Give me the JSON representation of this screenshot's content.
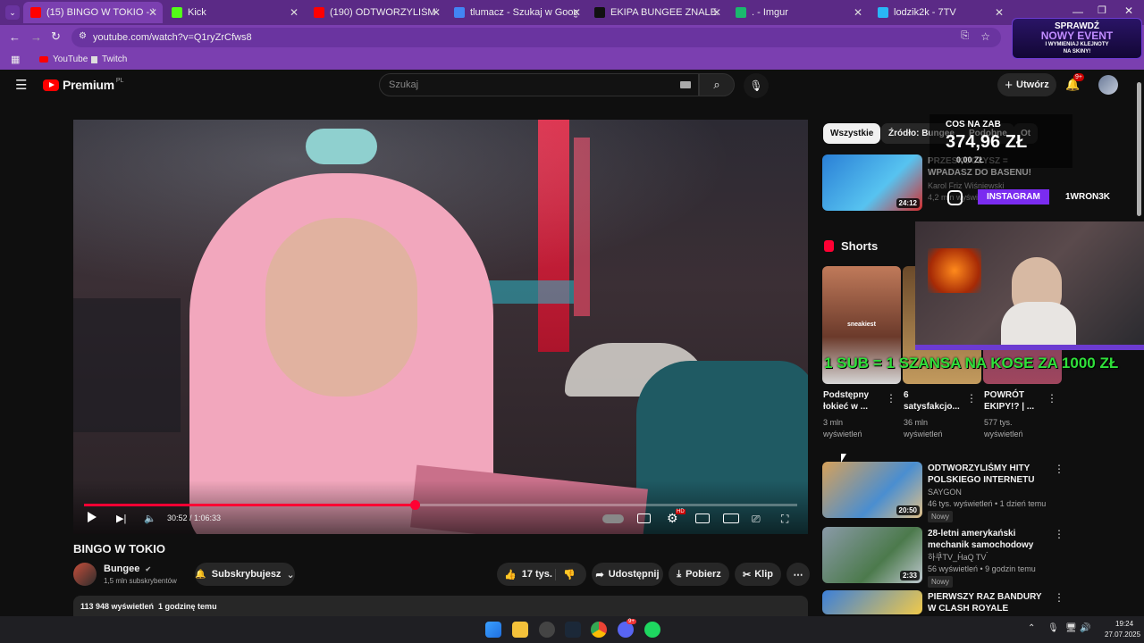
{
  "browser": {
    "tabs": [
      {
        "label": "(15) BINGO W TOKIO - You",
        "active": true,
        "color": "#ff0000"
      },
      {
        "label": "Kick",
        "color": "#53fc18"
      },
      {
        "label": "(190) ODTWORZYLIŚMY HITY P",
        "color": "#ff0000"
      },
      {
        "label": "tlumacz - Szukaj w Google",
        "color": "#4285f4"
      },
      {
        "label": "EKIPA BUNGEE ZNALEZIONA W",
        "color": "#111111"
      },
      {
        "label": ". - Imgur",
        "color": "#1bb76e"
      },
      {
        "label": "lodzik2k - 7TV",
        "color": "#29b6f6"
      }
    ],
    "url": "youtube.com/watch?v=Q1ryZrCfws8",
    "bookmarks": [
      "YouTube",
      "Twitch"
    ]
  },
  "youtube": {
    "logo_text": "Premium",
    "logo_region": "PL",
    "search_placeholder": "Szukaj",
    "create_label": "Utwórz",
    "notif_count": "9+",
    "chips": [
      "Wszystkie",
      "Źródło: Bungee",
      "Podobne",
      "Ot"
    ]
  },
  "player": {
    "time": "30:52 / 1:06:33",
    "progress": 0.464,
    "hd_badge": "HD"
  },
  "video": {
    "title": "BINGO W TOKIO",
    "channel": "Bungee",
    "subscribers": "1,5 mln subskrybentów",
    "subscribed_label": "Subskrybujesz",
    "likes": "17 tys.",
    "share_label": "Udostępnij",
    "download_label": "Pobierz",
    "clip_label": "Klip",
    "views_line": "113 948 wyświetleń  1 godzinę temu"
  },
  "sidebar": {
    "top_video": {
      "title": "PRZESKOCZYSZ = WPADASZ DO BASENU!",
      "channel": "Karol Friz Wiśniewski",
      "meta": "4,2 mln wyświetleń",
      "duration": "24:12"
    },
    "shorts_heading": "Shorts",
    "shorts": [
      {
        "title": "Podstępny łokieć w ...",
        "views": "3 mln",
        "views2": "wyświetleń",
        "overlay": "sneakiest"
      },
      {
        "title": "6 satysfakcjo...",
        "views": "36 mln",
        "views2": "wyświetleń"
      },
      {
        "title": "POWRÓT EKIPY!? | ...",
        "views": "577 tys.",
        "views2": "wyświetleń"
      }
    ],
    "videos": [
      {
        "title": "ODTWORZYLIŚMY HITY POLSKIEGO INTERNETU",
        "channel": "SAYGON",
        "meta": "46 tys. wyświetleń • 1 dzień temu",
        "badge": "Nowy",
        "duration": "20:50"
      },
      {
        "title": "28-letni amerykański mechanik samochodowy pokazuje swoje...",
        "channel": "하쿠TV_HaQ TV",
        "meta": "56 wyświetleń • 9 godzin temu",
        "badge": "Nowy",
        "duration": "2:33"
      },
      {
        "title": "PIERWSZY RAZ BANDURY W CLASH ROYALE",
        "channel": "",
        "meta": "",
        "badge": "",
        "duration": ""
      }
    ]
  },
  "stream_overlay": {
    "event_line1": "SPRAWDŹ",
    "event_line2": "NOWY EVENT",
    "event_line3": "I WYMIENIAJ KLEJNOTY",
    "event_line4": "NA SKINY!",
    "goal_label": "COS NA ZAB",
    "goal_amount": "374,96 ZŁ",
    "goal_sub": "0,00 ZŁ",
    "insta_label": "INSTAGRAM",
    "insta_handle": "1WRON3K",
    "banner": "1 SUB = 1 SZANSA NA KOSE ZA 1000 ZŁ"
  },
  "taskbar": {
    "time": "19:24",
    "date": "27.07.2025",
    "discord_badge": "9+"
  }
}
